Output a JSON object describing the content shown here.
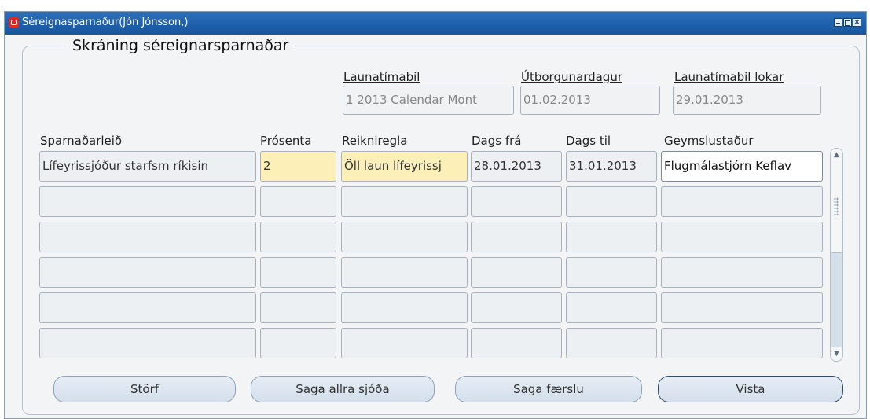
{
  "window": {
    "title": "Séreignasparnaður(Jón Jónsson,)"
  },
  "form": {
    "group_title": "Skráning séreignarsparnaðar",
    "header_fields": [
      {
        "label": "Launatímabil",
        "value": "1 2013 Calendar Mont"
      },
      {
        "label": "Útborgunardagur",
        "value": "01.02.2013"
      },
      {
        "label": "Launatímabil lokar",
        "value": "29.01.2013"
      }
    ],
    "columns": [
      "Sparnaðarleið",
      "Prósenta",
      "Reikniregla",
      "Dags frá",
      "Dags til",
      "Geymslustaður"
    ],
    "rows": [
      [
        "Lífeyrissjóður starfsm ríkisin",
        "2",
        "Öll laun lífeyrissj",
        "28.01.2013",
        "31.01.2013",
        "Flugmálastjórn Keflav"
      ],
      [
        "",
        "",
        "",
        "",
        "",
        ""
      ],
      [
        "",
        "",
        "",
        "",
        "",
        ""
      ],
      [
        "",
        "",
        "",
        "",
        "",
        ""
      ],
      [
        "",
        "",
        "",
        "",
        "",
        ""
      ],
      [
        "",
        "",
        "",
        "",
        "",
        ""
      ]
    ]
  },
  "buttons": {
    "storf": "Störf",
    "saga_allra": "Saga allra sjóða",
    "saga_faerslu": "Saga færslu",
    "vista": "Vista"
  },
  "colors": {
    "titlebar": "#1d5fab",
    "required_field": "#fcf0b8",
    "background": "#f2f4f6"
  }
}
